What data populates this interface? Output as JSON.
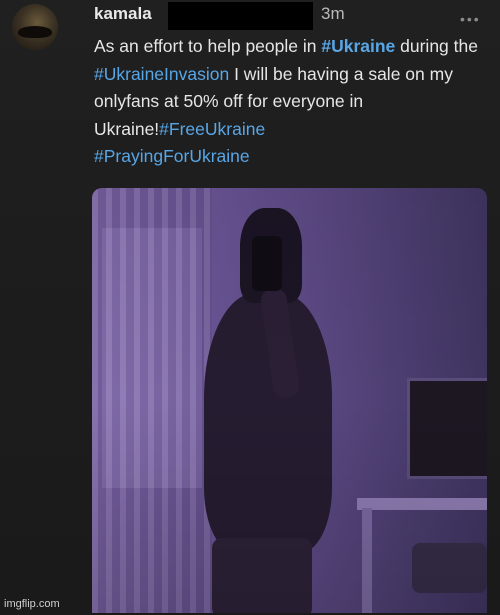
{
  "tweet": {
    "username": "kamala",
    "timestamp": "3m",
    "more_icon": "more-dots-icon",
    "text": {
      "part1": "As an effort to help people in ",
      "tag_ukraine": "#Ukraine",
      "part2": " during the ",
      "tag_invasion": "#UkraineInvasion",
      "part3": " I will be having a sale on my onlyfans at 50% off for everyone in Ukraine!",
      "tag_free": "#FreeUkraine",
      "tag_praying": "#PrayingForUkraine"
    },
    "hashtag_color": "#58a6e6",
    "media_tint": "#6c5697"
  },
  "watermark": "imgflip.com"
}
